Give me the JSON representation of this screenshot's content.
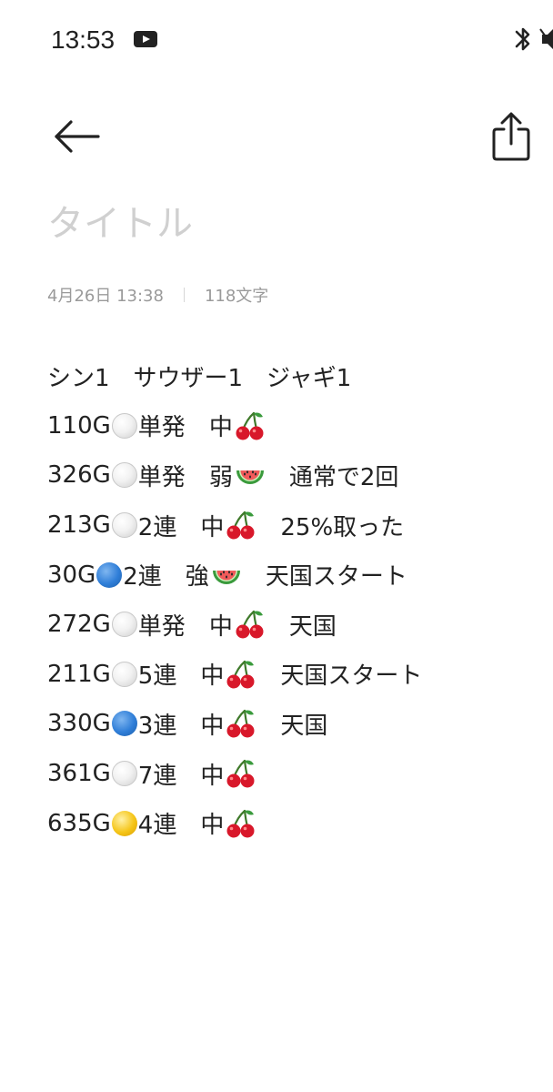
{
  "status_bar": {
    "time": "13:53"
  },
  "toolbar": {
    "back_icon": "arrow-left-icon",
    "share_icon": "share-icon"
  },
  "note": {
    "title_placeholder": "タイトル",
    "date": "4月26日 13:38",
    "char_count": "118文字",
    "header_line": "シン1　サウザー1　ジャギ1",
    "entries": [
      {
        "games": "110G",
        "ball": "white",
        "run": "単発",
        "role": "中",
        "role_icon": "cherry",
        "note": ""
      },
      {
        "games": "326G",
        "ball": "white",
        "run": "単発",
        "role": "弱",
        "role_icon": "watermelon",
        "note": "通常で2回"
      },
      {
        "games": "213G",
        "ball": "white",
        "run": "2連",
        "role": "中",
        "role_icon": "cherry",
        "note": "25%取った"
      },
      {
        "games": "30G",
        "ball": "blue",
        "run": "2連",
        "role": "強",
        "role_icon": "watermelon",
        "note": "天国スタート"
      },
      {
        "games": "272G",
        "ball": "white",
        "run": "単発",
        "role": "中",
        "role_icon": "cherry",
        "note": "天国"
      },
      {
        "games": "211G",
        "ball": "white",
        "run": "5連",
        "role": "中",
        "role_icon": "cherry",
        "note": "天国スタート"
      },
      {
        "games": "330G",
        "ball": "blue",
        "run": "3連",
        "role": "中",
        "role_icon": "cherry",
        "note": "天国"
      },
      {
        "games": "361G",
        "ball": "white",
        "run": "7連",
        "role": "中",
        "role_icon": "cherry",
        "note": ""
      },
      {
        "games": "635G",
        "ball": "yellow",
        "run": "4連",
        "role": "中",
        "role_icon": "cherry",
        "note": ""
      }
    ]
  },
  "colors": {
    "white_ball": "#e6e6e6",
    "blue_ball": "#2f7ed8",
    "yellow_ball": "#f5c518",
    "cherry_red": "#d8182a",
    "melon_green": "#3a9a3c",
    "melon_flesh": "#f15a5a"
  }
}
